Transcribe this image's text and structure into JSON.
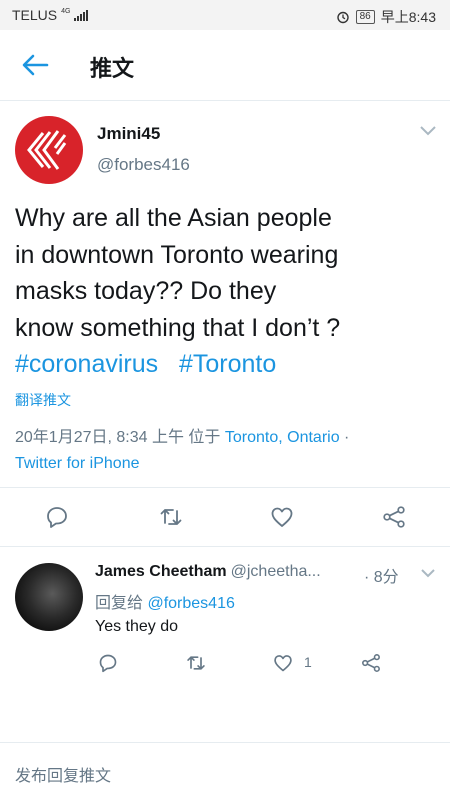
{
  "status_bar": {
    "carrier": "TELUS",
    "network": "4G",
    "battery": "86",
    "time": "早上8:43"
  },
  "header": {
    "title": "推文"
  },
  "tweet": {
    "author_name": "Jmini45",
    "author_handle": "@forbes416",
    "text_lines": [
      "Why are all the Asian people",
      "in downtown Toronto wearing",
      "masks today??  Do they",
      "know something that I don’t ?"
    ],
    "hashtags": "#coronavirus   #Toronto",
    "translate_label": "翻译推文",
    "timestamp": "20年1月27日, 8:34 上午 位于 ",
    "location": "Toronto, Ontario",
    "separator": " ·",
    "client": "Twitter for iPhone"
  },
  "reply": {
    "author_name": "James Cheetham",
    "author_handle": "@jcheetha...",
    "time": "· 8分",
    "replying_to_prefix": "回复给 ",
    "replying_to_handle": "@forbes416",
    "text": "Yes they do",
    "like_count": "1"
  },
  "compose": {
    "placeholder": "发布回复推文"
  },
  "colors": {
    "accent": "#1b95e0",
    "secondary_text": "#657786",
    "avatar_red": "#d8232a"
  },
  "icons": [
    "back-arrow-icon",
    "chevron-down-icon",
    "reply-icon",
    "retweet-icon",
    "like-icon",
    "share-icon",
    "alarm-icon"
  ]
}
